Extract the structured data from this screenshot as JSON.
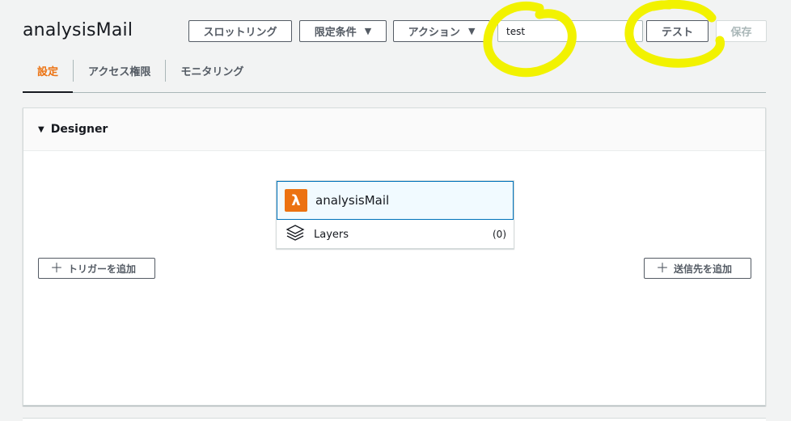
{
  "header": {
    "title": "analysisMail",
    "throttle_label": "スロットリング",
    "qualifier_label": "限定条件",
    "actions_label": "アクション",
    "test_event_value": "test",
    "test_label": "テスト",
    "save_label": "保存"
  },
  "tabs": [
    {
      "label": "設定",
      "active": true
    },
    {
      "label": "アクセス権限",
      "active": false
    },
    {
      "label": "モニタリング",
      "active": false
    }
  ],
  "designer": {
    "title": "Designer",
    "function_name": "analysisMail",
    "layers_label": "Layers",
    "layers_count": "(0)",
    "add_trigger_label": "トリガーを追加",
    "add_destination_label": "送信先を追加"
  },
  "icons": {
    "dropdown": "caret-down-icon",
    "collapse": "triangle-down-icon",
    "lambda": "lambda-icon",
    "layers": "layers-icon",
    "add": "plus-icon"
  },
  "colors": {
    "accent": "#ec7211",
    "selection_border": "#0073bb",
    "annotation_highlight": "#f2f200"
  }
}
